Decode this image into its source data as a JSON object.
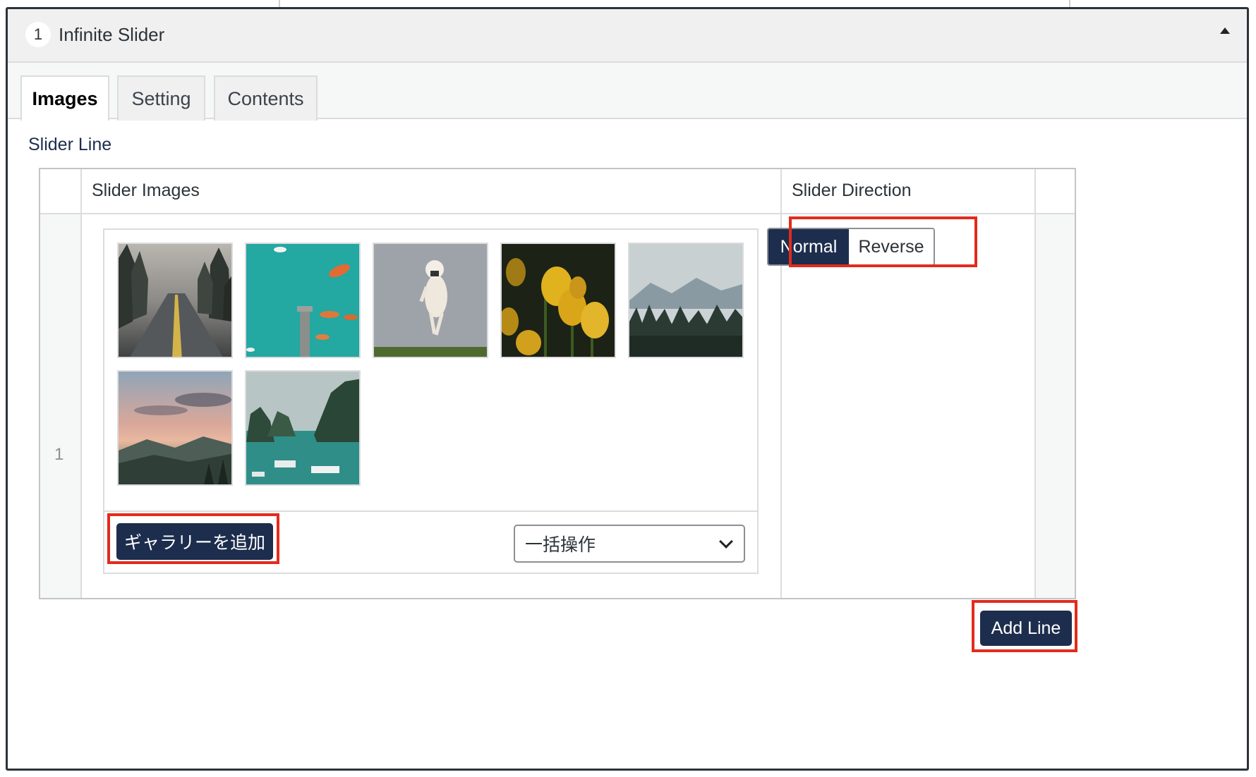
{
  "header": {
    "number": "1",
    "title": "Infinite Slider"
  },
  "tabs": [
    {
      "label": "Images",
      "active": true
    },
    {
      "label": "Setting",
      "active": false
    },
    {
      "label": "Contents",
      "active": false
    }
  ],
  "section": {
    "title": "Slider Line"
  },
  "table": {
    "col_images": "Slider Images",
    "col_direction": "Slider Direction",
    "row_number": "1"
  },
  "gallery": {
    "images": [
      {
        "subject": "misty forest road"
      },
      {
        "subject": "aerial turquoise sea with boats"
      },
      {
        "subject": "jumping dog"
      },
      {
        "subject": "yellow tulips"
      },
      {
        "subject": "foggy mountains and forest"
      },
      {
        "subject": "sunset over mountains"
      },
      {
        "subject": "bay with boats and cliffs"
      }
    ],
    "add_button": "ギャラリーを追加",
    "bulk_select": "一括操作"
  },
  "direction": {
    "normal": "Normal",
    "reverse": "Reverse",
    "selected": "Normal"
  },
  "add_line_button": "Add Line",
  "colors": {
    "accent": "#1d2d4d",
    "highlight": "#e22b1c"
  }
}
